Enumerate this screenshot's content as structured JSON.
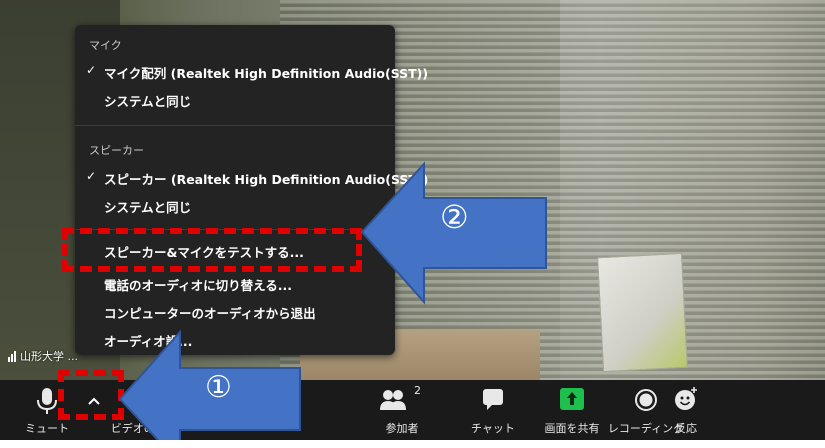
{
  "participant": {
    "name": "山形大学 ..."
  },
  "menu": {
    "mic_header": "マイク",
    "mic_items": [
      {
        "label": "マイク配列 (Realtek High Definition Audio(SST))",
        "checked": true
      },
      {
        "label": "システムと同じ",
        "checked": false
      }
    ],
    "speaker_header": "スピーカー",
    "speaker_items": [
      {
        "label": "スピーカー (Realtek High Definition Audio(SST))",
        "checked": true
      },
      {
        "label": "システムと同じ",
        "checked": false
      }
    ],
    "actions": [
      "スピーカー&マイクをテストする...",
      "電話のオーディオに切り替える...",
      "コンピューターのオーディオから退出",
      "オーディオ設..."
    ],
    "check_mark": "✓"
  },
  "toolbar": {
    "mute": "ミュート",
    "video": "ビデオの...",
    "participants": "参加者",
    "participants_count": "2",
    "chat": "チャット",
    "share": "画面を共有",
    "record": "レコーディング",
    "reactions": "反応",
    "caret": "^"
  },
  "annotations": {
    "step1": "①",
    "step2": "②"
  },
  "colors": {
    "accent_red": "#e00000",
    "arrow_blue": "#4472c4",
    "share_green": "#1fbf4d",
    "toolbar_bg": "#1a1a1a",
    "menu_bg": "#232323"
  },
  "icons": [
    "microphone-icon",
    "chevron-up-icon",
    "participants-icon",
    "chat-icon",
    "share-screen-icon",
    "record-icon",
    "reaction-icon",
    "signal-icon"
  ]
}
